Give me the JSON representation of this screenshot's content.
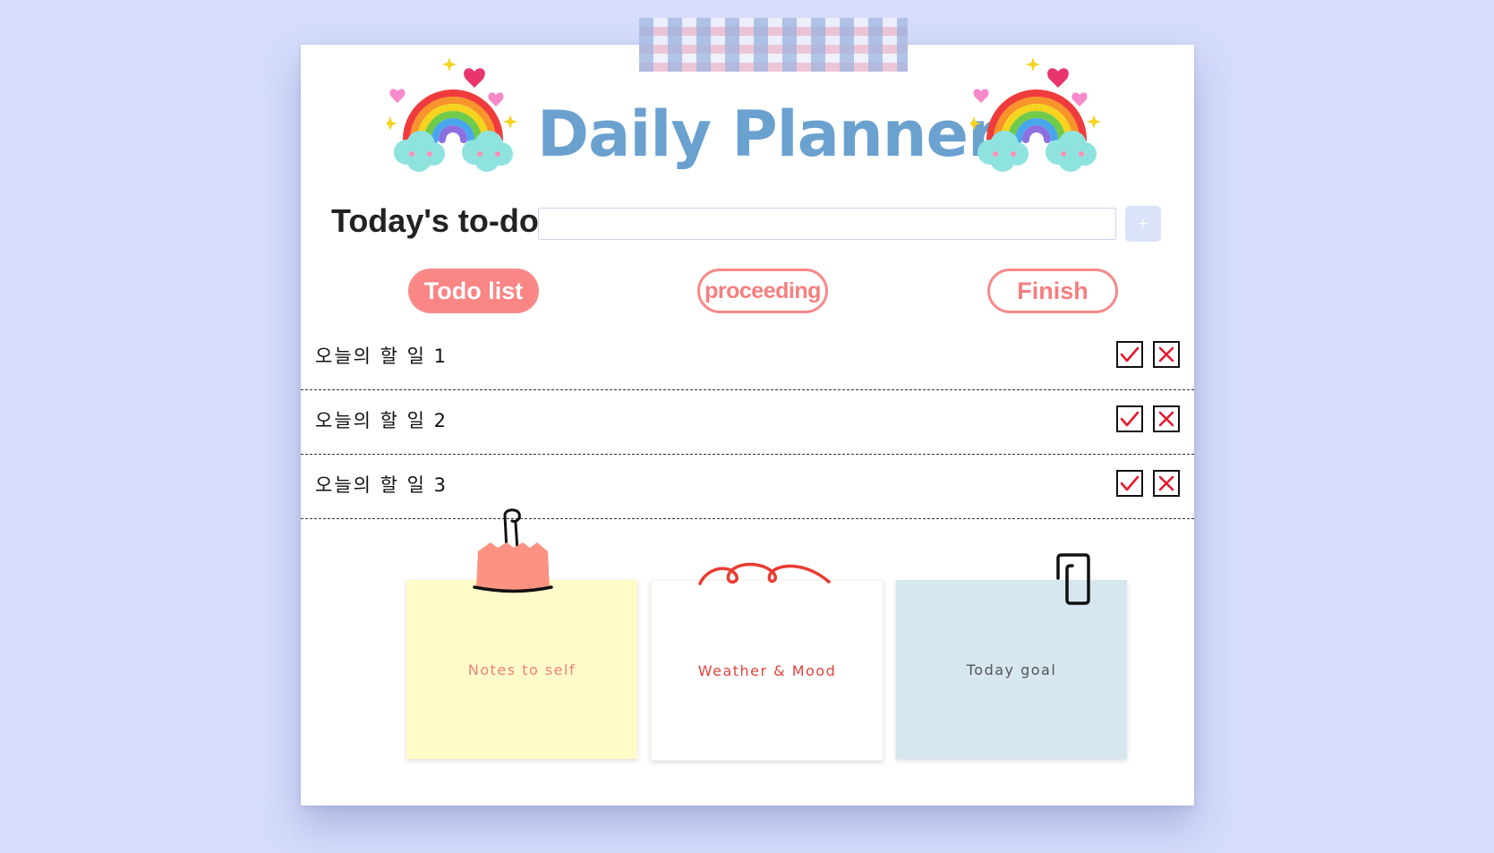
{
  "header": {
    "title": "Daily Planner"
  },
  "todo_input": {
    "label": "Today's to-do :",
    "value": "",
    "placeholder": "",
    "add_button_label": "+"
  },
  "tabs": [
    {
      "label": "Todo list",
      "active": true
    },
    {
      "label": "proceeding",
      "active": false
    },
    {
      "label": "Finish",
      "active": false
    }
  ],
  "todos": [
    {
      "text": "오늘의 할 일 1"
    },
    {
      "text": "오늘의 할 일 2"
    },
    {
      "text": "오늘의 할 일 3"
    }
  ],
  "notes": [
    {
      "label": "Notes to self"
    },
    {
      "label": "Weather & Mood"
    },
    {
      "label": "Today goal"
    }
  ],
  "icons": {
    "check": "check-icon",
    "delete": "close-icon",
    "rainbow": "rainbow-icon",
    "binder_clip": "binder-clip-icon",
    "paper_clip": "paper-clip-icon"
  },
  "colors": {
    "background": "#d6dcfa",
    "title": "#6aa1cf",
    "tab_accent": "#f98585",
    "check": "#e8192c",
    "note_yellow": "#fffbc8",
    "note_blue": "#d6e7ef"
  }
}
